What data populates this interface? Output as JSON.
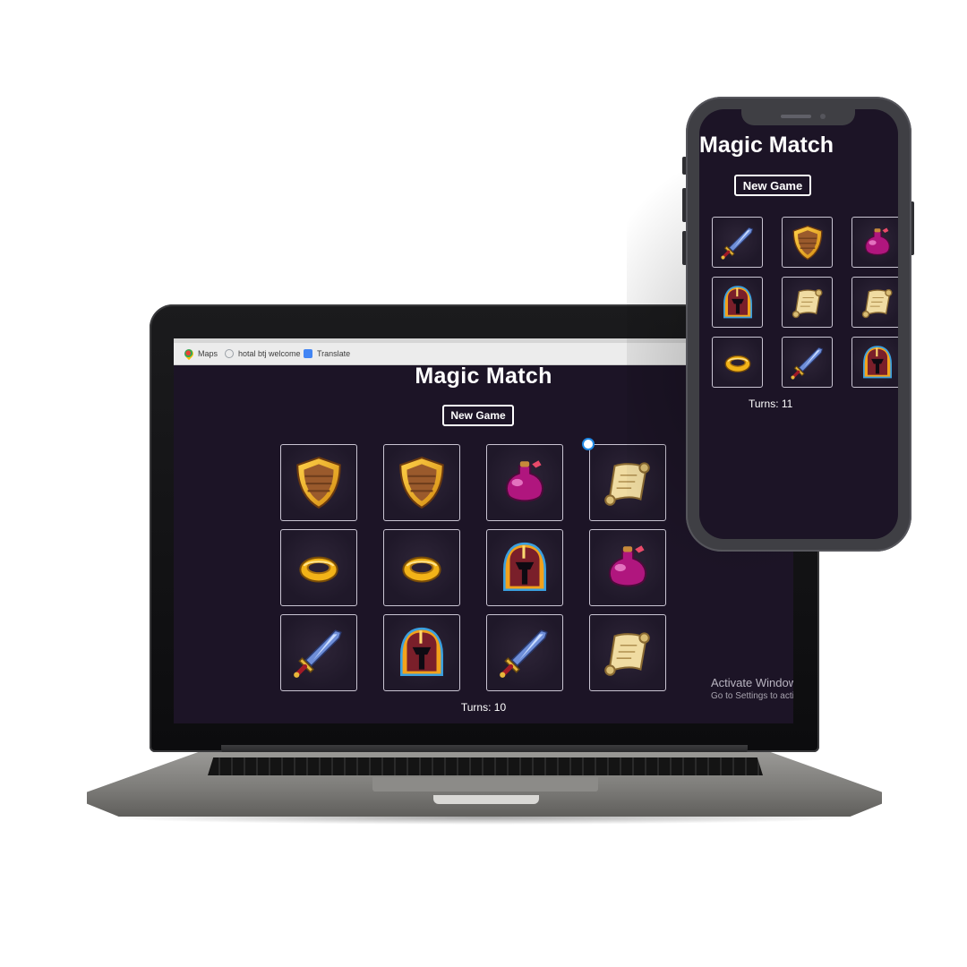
{
  "browser": {
    "bookmarks": [
      {
        "label": "Maps",
        "icon": "maps-icon"
      },
      {
        "label": "hotal btj welcome",
        "icon": "web-icon"
      },
      {
        "label": "Translate",
        "icon": "translate-icon"
      }
    ]
  },
  "laptop_game": {
    "title": "Magic Match",
    "new_game_label": "New Game",
    "turns_text": "Turns: 10",
    "cards": [
      "shield",
      "shield",
      "potion",
      "scroll",
      "ring",
      "ring",
      "helmet",
      "potion",
      "sword",
      "helmet",
      "sword",
      "scroll"
    ]
  },
  "phone_game": {
    "title": "Magic Match",
    "new_game_label": "New Game",
    "turns_text": "Turns: 11",
    "cards": [
      "sword",
      "shield",
      "potion",
      "helmet",
      "scroll",
      "scroll",
      "ring",
      "sword",
      "helmet"
    ]
  },
  "os_watermark": {
    "line1": "Activate Windows",
    "line2": "Go to Settings to activate Windows."
  },
  "colors": {
    "game_background": "#1c1426",
    "card_border": "#c9c4d2",
    "text": "#ffffff"
  }
}
